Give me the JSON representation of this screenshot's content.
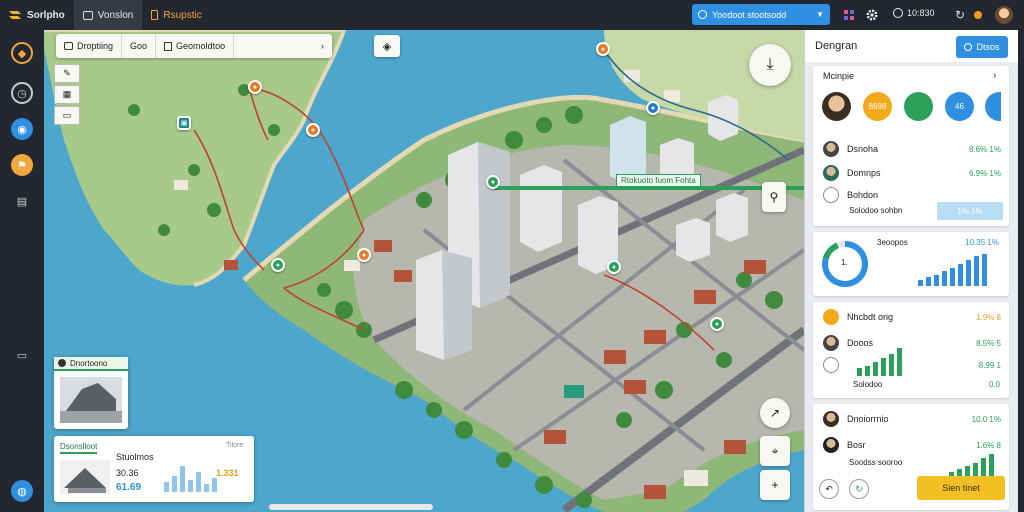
{
  "topbar": {
    "brand": "Sorlpho",
    "tab_active": "Vonslon",
    "tab_secondary": "Rsupstic",
    "search_text": "Yoodoot stootsodd",
    "clock_text": "10:830"
  },
  "map": {
    "toolbar": {
      "first_label": "Droptiing",
      "second_label": "Goo",
      "third_label": "Geomoldtoo"
    },
    "route_label": "Rtokuoto fuom Fohta",
    "card_top": {
      "title": "Dnortoono"
    },
    "card_bottom": {
      "title": "Dsonslloot",
      "badge": "Tilore",
      "label": "Stuolmos",
      "value_dark": "30.36",
      "value_orange": "1.331",
      "value_blue": "61.69"
    }
  },
  "panel": {
    "title": "Dengran",
    "top_button": "Dtsos",
    "section_label": "Mcinpie",
    "circles": [
      "",
      "8698",
      "",
      "46"
    ],
    "list1": [
      {
        "label": "Dsnoha",
        "value": "8.6% 1%"
      },
      {
        "label": "Domnps",
        "value": "6.9% 1%"
      },
      {
        "label": "Bohdon",
        "value": ""
      }
    ],
    "list1_extra_label": "Solodoo sohbn",
    "list1_box_value": "1% 1%",
    "donut_title": "3eoopos",
    "donut_center": "1.",
    "donut_value": "10.35 1%",
    "list2": [
      {
        "label": "Nhcbdt orig",
        "value": "1.9% 8"
      },
      {
        "label": "Dooos",
        "value": "8.5% 5"
      },
      {
        "label": "",
        "value": "8.99 1"
      }
    ],
    "list2_extra_label": "Solodoo",
    "list2_extra_value": "0.0",
    "list3": [
      {
        "label": "Dnoiorrnio",
        "value": "10.0 1%"
      },
      {
        "label": "Bosr",
        "value": "1.6% 8"
      }
    ],
    "list3_extra_label": "Soodss sooroo",
    "action_button": "Sien tinet"
  },
  "colors": {
    "accent_blue": "#2f8fe0",
    "accent_green": "#2aa05a",
    "accent_orange": "#e8a020",
    "action_yellow": "#f2c022"
  }
}
